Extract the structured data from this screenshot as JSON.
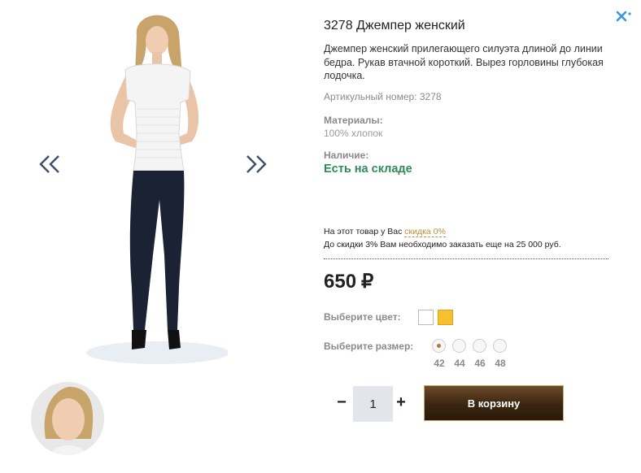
{
  "product": {
    "title": "3278 Джемпер женский",
    "description": "Джемпер женский прилегающего силуэта длиной до линии бедра. Рукав втачной короткий. Вырез горловины глубокая лодочка.",
    "article": "Артикульный номер: 3278",
    "materials_label": "Материалы:",
    "materials_value": "100% хлопок",
    "availability_label": "Наличие:",
    "availability_value": "Есть на складе"
  },
  "discount": {
    "line1_prefix": "На этот товар у Вас ",
    "line1_link": "скидка 0%",
    "line2": "До скидки 3% Вам необходимо заказать еще на 25 000 руб."
  },
  "price": {
    "amount": "650",
    "currency": "₽"
  },
  "color": {
    "label": "Выберите цвет:",
    "options": [
      "#ffffff",
      "#f7c02c"
    ]
  },
  "size": {
    "label": "Выберите размер:",
    "options": [
      "42",
      "44",
      "46",
      "48"
    ],
    "selected": "42"
  },
  "quantity": {
    "minus": "−",
    "value": "1",
    "plus": "+"
  },
  "cart": {
    "label": "В корзину"
  },
  "icons": {
    "close": "close-icon",
    "prev": "chevron-double-left-icon",
    "next": "chevron-double-right-icon"
  }
}
